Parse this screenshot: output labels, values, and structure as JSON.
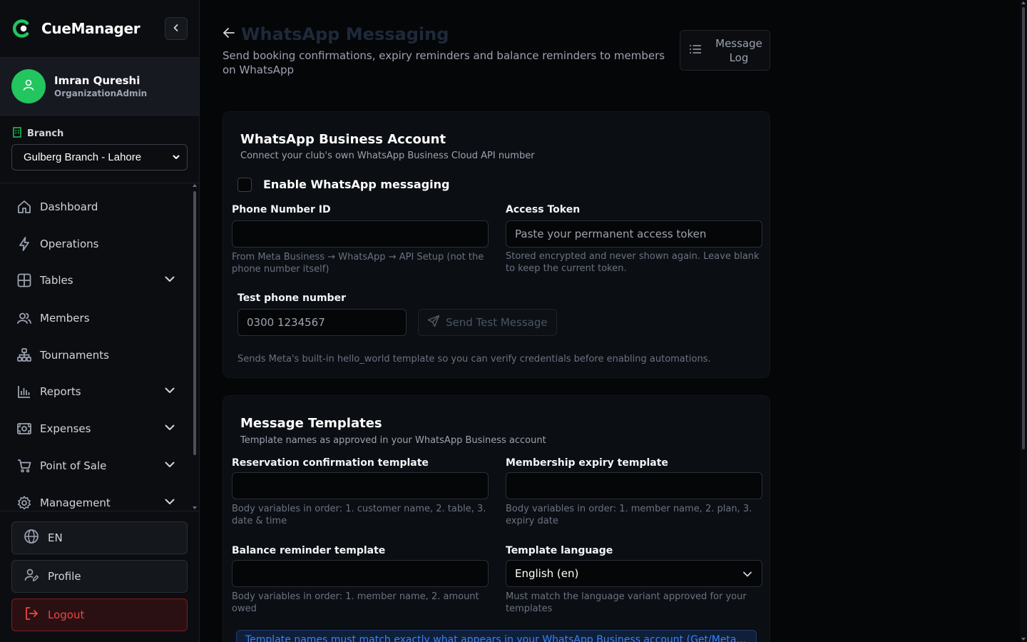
{
  "app": {
    "name": "CueManager",
    "accent_color": "#22c55e"
  },
  "user": {
    "name": "Imran Qureshi",
    "role": "OrganizationAdmin"
  },
  "branch": {
    "label": "Branch",
    "selected": "Gulberg Branch - Lahore"
  },
  "sidebar": {
    "items": [
      {
        "label": "Dashboard",
        "icon": "home-icon",
        "expandable": false
      },
      {
        "label": "Operations",
        "icon": "bolt-icon",
        "expandable": false
      },
      {
        "label": "Tables",
        "icon": "grid-icon",
        "expandable": true
      },
      {
        "label": "Members",
        "icon": "users-icon",
        "expandable": false
      },
      {
        "label": "Tournaments",
        "icon": "bracket-icon",
        "expandable": false
      },
      {
        "label": "Reports",
        "icon": "bar-chart-icon",
        "expandable": true
      },
      {
        "label": "Expenses",
        "icon": "banknote-icon",
        "expandable": true
      },
      {
        "label": "Point of Sale",
        "icon": "cart-icon",
        "expandable": true
      },
      {
        "label": "Management",
        "icon": "gear-icon",
        "expandable": true
      }
    ],
    "language_label": "EN",
    "profile_label": "Profile",
    "logout_label": "Logout"
  },
  "page": {
    "title": "WhatsApp Messaging",
    "subtitle": "Send booking confirmations, expiry reminders and balance reminders to members on WhatsApp",
    "message_log_label": "Message Log"
  },
  "business_account": {
    "title": "WhatsApp Business Account",
    "description": "Connect your club's own WhatsApp Business Cloud API number",
    "enable_label": "Enable WhatsApp messaging",
    "enabled": false,
    "phone_number_id": {
      "label": "Phone Number ID",
      "value": "",
      "hint": "From Meta Business → WhatsApp → API Setup (not the phone number itself)"
    },
    "access_token": {
      "label": "Access Token",
      "placeholder": "Paste your permanent access token",
      "hint": "Stored encrypted and never shown again. Leave blank to keep the current token."
    },
    "test_phone": {
      "label": "Test phone number",
      "placeholder": "0300 1234567"
    },
    "send_test_label": "Send Test Message",
    "test_hint": "Sends Meta's built-in hello_world template so you can verify credentials before enabling automations."
  },
  "templates": {
    "title": "Message Templates",
    "description": "Template names as approved in your WhatsApp Business account",
    "reservation": {
      "label": "Reservation confirmation template",
      "value": "",
      "hint": "Body variables in order: 1. customer name, 2. table, 3. date & time"
    },
    "expiry": {
      "label": "Membership expiry template",
      "value": "",
      "hint": "Body variables in order: 1. member name, 2. plan, 3. expiry date"
    },
    "balance": {
      "label": "Balance reminder template",
      "value": "",
      "hint": "Body variables in order: 1. member name, 2. amount owed"
    },
    "language": {
      "label": "Template language",
      "selected": "English (en)",
      "hint": "Must match the language variant approved for your templates"
    },
    "info_text": "Template names must match exactly what appears in your WhatsApp Business account (Get/Meta..."
  }
}
